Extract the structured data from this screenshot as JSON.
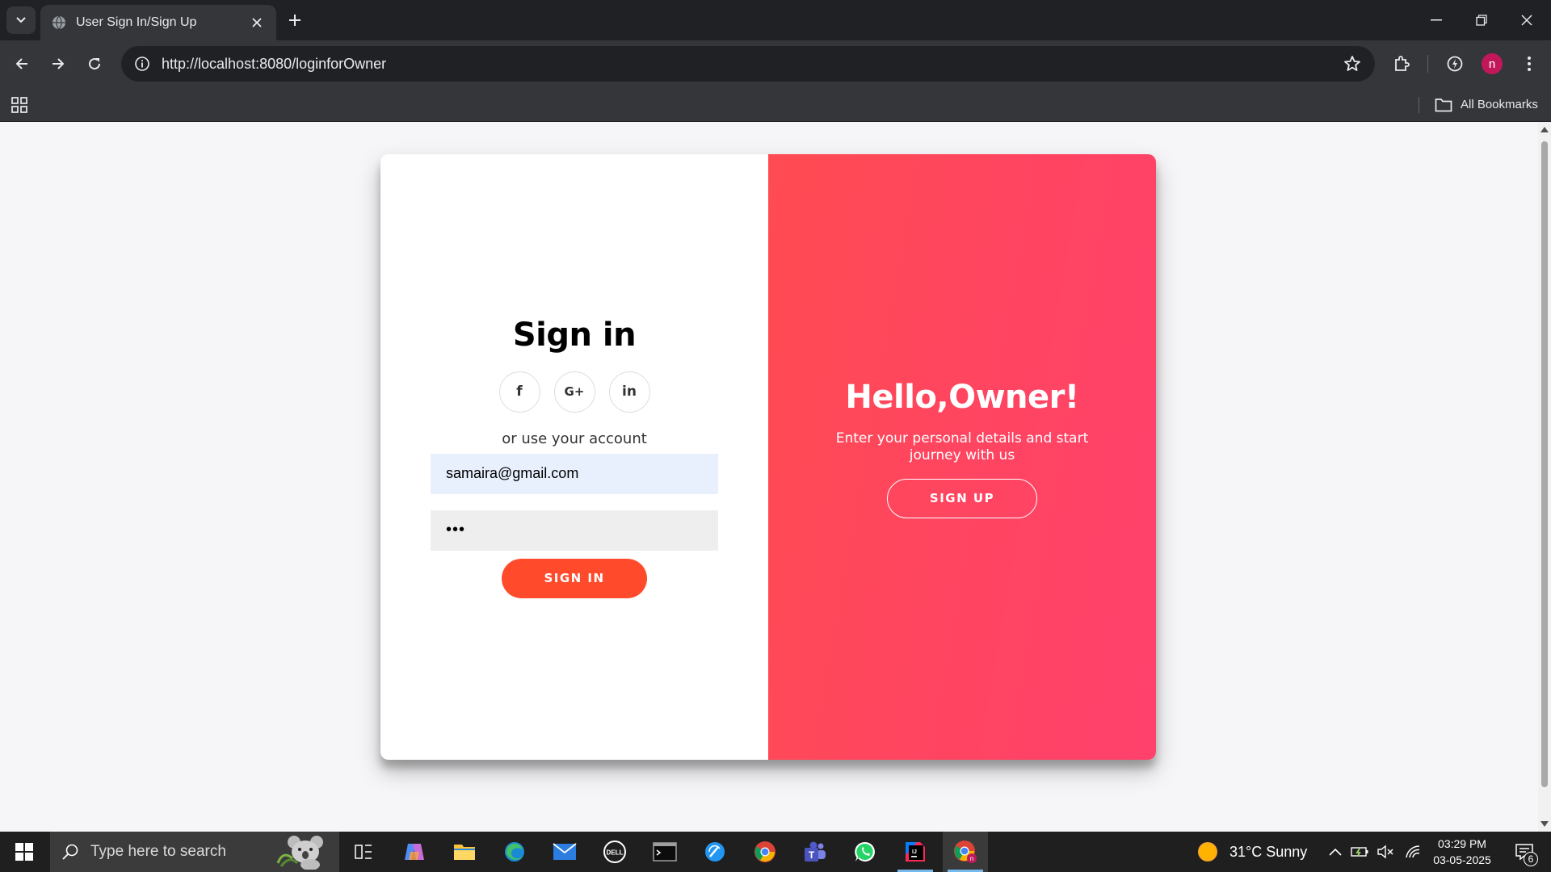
{
  "browser": {
    "tab_title": "User Sign In/Sign Up",
    "url": "http://localhost:8080/loginforOwner",
    "profile_initial": "n",
    "bookmarks_label": "All Bookmarks"
  },
  "signin": {
    "title": "Sign in",
    "socials": [
      {
        "icon": "facebook-icon",
        "glyph": "f"
      },
      {
        "icon": "google-plus-icon",
        "glyph": "G+"
      },
      {
        "icon": "linkedin-icon",
        "glyph": "in"
      }
    ],
    "alt_text": "or use your account",
    "email_value": "samaira@gmail.com",
    "password_value": "•••",
    "button_label": "SIGN IN"
  },
  "overlay": {
    "title": "Hello,Owner!",
    "text": "Enter your personal details and start journey with us",
    "button_label": "SIGN UP"
  },
  "colors": {
    "primary": "#ff4b2b",
    "gradient_start": "#ff4b52",
    "gradient_end": "#ff416c"
  },
  "taskbar": {
    "search_placeholder": "Type here to search",
    "weather": "31°C  Sunny",
    "time": "03:29 PM",
    "date": "03-05-2025",
    "notification_count": "6"
  }
}
